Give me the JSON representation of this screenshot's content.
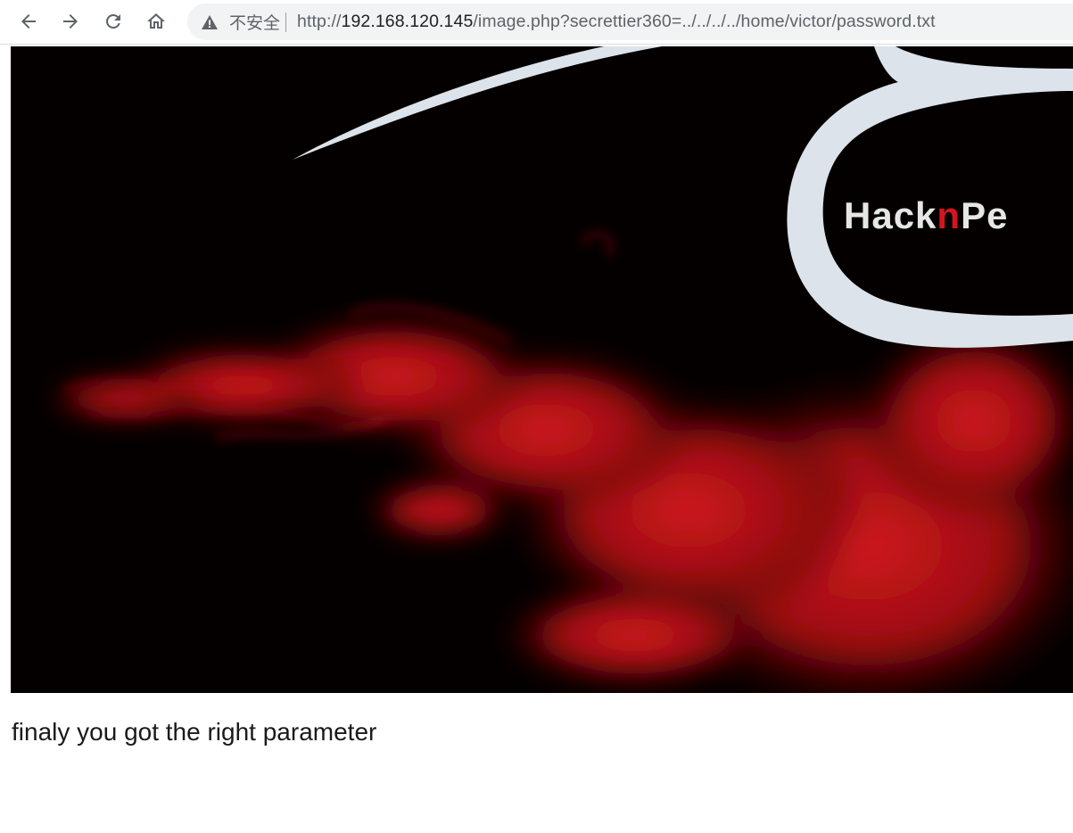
{
  "browser": {
    "nav": {
      "back_icon": "arrow-left-icon",
      "forward_icon": "arrow-right-icon",
      "reload_icon": "reload-icon",
      "home_icon": "home-icon"
    },
    "address_bar": {
      "security_icon": "warning-triangle-icon",
      "security_label": "不安全",
      "url_scheme": "http://",
      "url_host": "192.168.120.145",
      "url_path": "/image.php?secrettier360=../../../../home/victor/password.txt"
    }
  },
  "page": {
    "banner": {
      "logo_text": "HacknPe",
      "colors": {
        "background": "#050000",
        "smoke": "#c0141a",
        "logo_ring": "#dce3ea"
      }
    },
    "message": "finaly you got the right parameter"
  }
}
